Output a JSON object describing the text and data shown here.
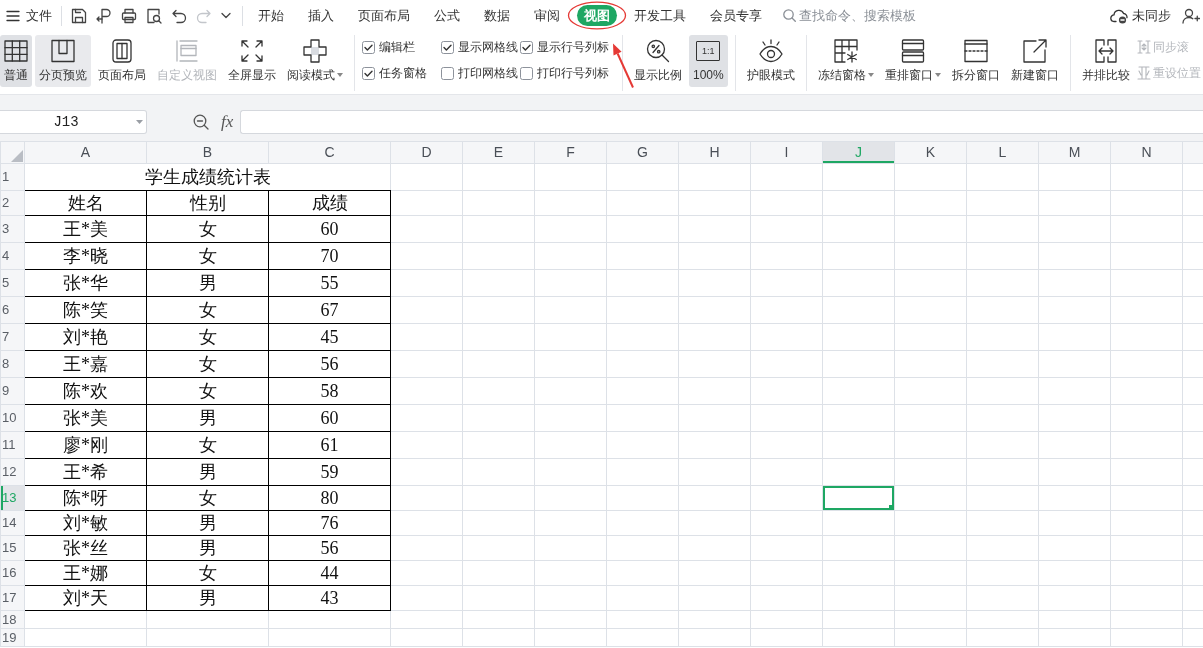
{
  "menu_bar": {
    "file_menu": "文件",
    "quick_access": [
      {
        "disabled": false
      },
      {
        "disabled": false
      },
      {
        "disabled": false
      },
      {
        "disabled": false
      },
      {
        "disabled": false
      },
      {
        "disabled": true
      },
      {
        "disabled": false
      }
    ],
    "tabs": [
      {
        "label": "开始",
        "selected": false
      },
      {
        "label": "插入",
        "selected": false
      },
      {
        "label": "页面布局",
        "selected": false
      },
      {
        "label": "公式",
        "selected": false
      },
      {
        "label": "数据",
        "selected": false
      },
      {
        "label": "审阅",
        "selected": false
      },
      {
        "label": "视图",
        "selected": true
      },
      {
        "label": "开发工具",
        "selected": false
      },
      {
        "label": "会员专享",
        "selected": false
      }
    ],
    "search": {
      "placeholder": "查找命令、搜索模板"
    },
    "sync_status": "未同步"
  },
  "ribbon": {
    "groups": [
      {
        "items": [
          {
            "kind": "large",
            "label": "普通",
            "selected": true,
            "hovered": false,
            "disabled": false,
            "dropdown": false
          },
          {
            "kind": "large",
            "label": "分页预览",
            "selected": false,
            "hovered": true,
            "disabled": false,
            "dropdown": false
          },
          {
            "kind": "large",
            "label": "页面布局",
            "selected": false,
            "hovered": false,
            "disabled": false,
            "dropdown": false
          },
          {
            "kind": "large",
            "label": "自定义视图",
            "selected": false,
            "hovered": false,
            "disabled": true,
            "dropdown": false
          },
          {
            "kind": "large",
            "label": "全屏显示",
            "selected": false,
            "hovered": false,
            "disabled": false,
            "dropdown": false
          },
          {
            "kind": "large",
            "label": "阅读模式",
            "selected": false,
            "hovered": false,
            "disabled": false,
            "dropdown": true
          }
        ]
      },
      {
        "items": [
          {
            "kind": "checkbox",
            "label": "编辑栏",
            "checked": true
          },
          {
            "kind": "checkbox",
            "label": "显示网格线",
            "checked": true
          },
          {
            "kind": "checkbox",
            "label": "显示行号列标",
            "checked": true
          },
          {
            "kind": "checkbox",
            "label": "任务窗格",
            "checked": true
          },
          {
            "kind": "checkbox",
            "label": "打印网格线",
            "checked": false
          },
          {
            "kind": "checkbox",
            "label": "打印行号列标",
            "checked": false
          }
        ]
      },
      {
        "items": [
          {
            "kind": "large",
            "label": "显示比例",
            "selected": false,
            "hovered": false,
            "disabled": false,
            "dropdown": false
          },
          {
            "kind": "large",
            "label": "100%",
            "icon_text": "1:1",
            "selected": true,
            "hovered": false,
            "disabled": false,
            "dropdown": false
          }
        ]
      },
      {
        "items": [
          {
            "kind": "large",
            "label": "护眼模式",
            "selected": false,
            "hovered": false,
            "disabled": false,
            "dropdown": false
          }
        ]
      },
      {
        "items": [
          {
            "kind": "large",
            "label": "冻结窗格",
            "selected": false,
            "hovered": false,
            "disabled": false,
            "dropdown": true
          },
          {
            "kind": "large",
            "label": "重排窗口",
            "selected": false,
            "hovered": false,
            "disabled": false,
            "dropdown": true
          },
          {
            "kind": "large",
            "label": "拆分窗口",
            "selected": false,
            "hovered": false,
            "disabled": false,
            "dropdown": false
          },
          {
            "kind": "large",
            "label": "新建窗口",
            "selected": false,
            "hovered": false,
            "disabled": false,
            "dropdown": false
          }
        ]
      },
      {
        "items": [
          {
            "kind": "large",
            "label": "并排比较",
            "selected": false,
            "hovered": false,
            "disabled": false,
            "dropdown": false
          },
          {
            "kind": "small",
            "label": "同步滚",
            "disabled": true
          },
          {
            "kind": "small",
            "label": "重设位置",
            "disabled": true
          }
        ]
      }
    ]
  },
  "formula_bar": {
    "name_box": "J13",
    "function_label": "fx"
  },
  "sheet": {
    "columns": [
      {
        "label": "A",
        "selected": false
      },
      {
        "label": "B",
        "selected": false
      },
      {
        "label": "C",
        "selected": false
      },
      {
        "label": "D",
        "selected": false
      },
      {
        "label": "E",
        "selected": false
      },
      {
        "label": "F",
        "selected": false
      },
      {
        "label": "G",
        "selected": false
      },
      {
        "label": "H",
        "selected": false
      },
      {
        "label": "I",
        "selected": false
      },
      {
        "label": "J",
        "selected": true
      },
      {
        "label": "K",
        "selected": false
      },
      {
        "label": "L",
        "selected": false
      },
      {
        "label": "M",
        "selected": false
      },
      {
        "label": "N",
        "selected": false
      }
    ],
    "rows": [
      {
        "label": "1",
        "selected": false
      },
      {
        "label": "2",
        "selected": false
      },
      {
        "label": "3",
        "selected": false
      },
      {
        "label": "4",
        "selected": false
      },
      {
        "label": "5",
        "selected": false
      },
      {
        "label": "6",
        "selected": false
      },
      {
        "label": "7",
        "selected": false
      },
      {
        "label": "8",
        "selected": false
      },
      {
        "label": "9",
        "selected": false
      },
      {
        "label": "10",
        "selected": false
      },
      {
        "label": "11",
        "selected": false
      },
      {
        "label": "12",
        "selected": false
      },
      {
        "label": "13",
        "selected": true
      },
      {
        "label": "14",
        "selected": false
      },
      {
        "label": "15",
        "selected": false
      },
      {
        "label": "16",
        "selected": false
      },
      {
        "label": "17",
        "selected": false
      },
      {
        "label": "18",
        "selected": false
      },
      {
        "label": "19",
        "selected": false
      }
    ],
    "title": "学生成绩统计表",
    "table": {
      "header": [
        "姓名",
        "性别",
        "成绩"
      ],
      "rows": [
        [
          "王*美",
          "女",
          "60"
        ],
        [
          "李*晓",
          "女",
          "70"
        ],
        [
          "张*华",
          "男",
          "55"
        ],
        [
          "陈*笑",
          "女",
          "67"
        ],
        [
          "刘*艳",
          "女",
          "45"
        ],
        [
          "王*嘉",
          "女",
          "56"
        ],
        [
          "陈*欢",
          "女",
          "58"
        ],
        [
          "张*美",
          "男",
          "60"
        ],
        [
          "廖*刚",
          "女",
          "61"
        ],
        [
          "王*希",
          "男",
          "59"
        ],
        [
          "陈*呀",
          "女",
          "80"
        ],
        [
          "刘*敏",
          "男",
          "76"
        ],
        [
          "张*丝",
          "男",
          "56"
        ],
        [
          "王*娜",
          "女",
          "44"
        ],
        [
          "刘*天",
          "男",
          "43"
        ]
      ]
    }
  }
}
